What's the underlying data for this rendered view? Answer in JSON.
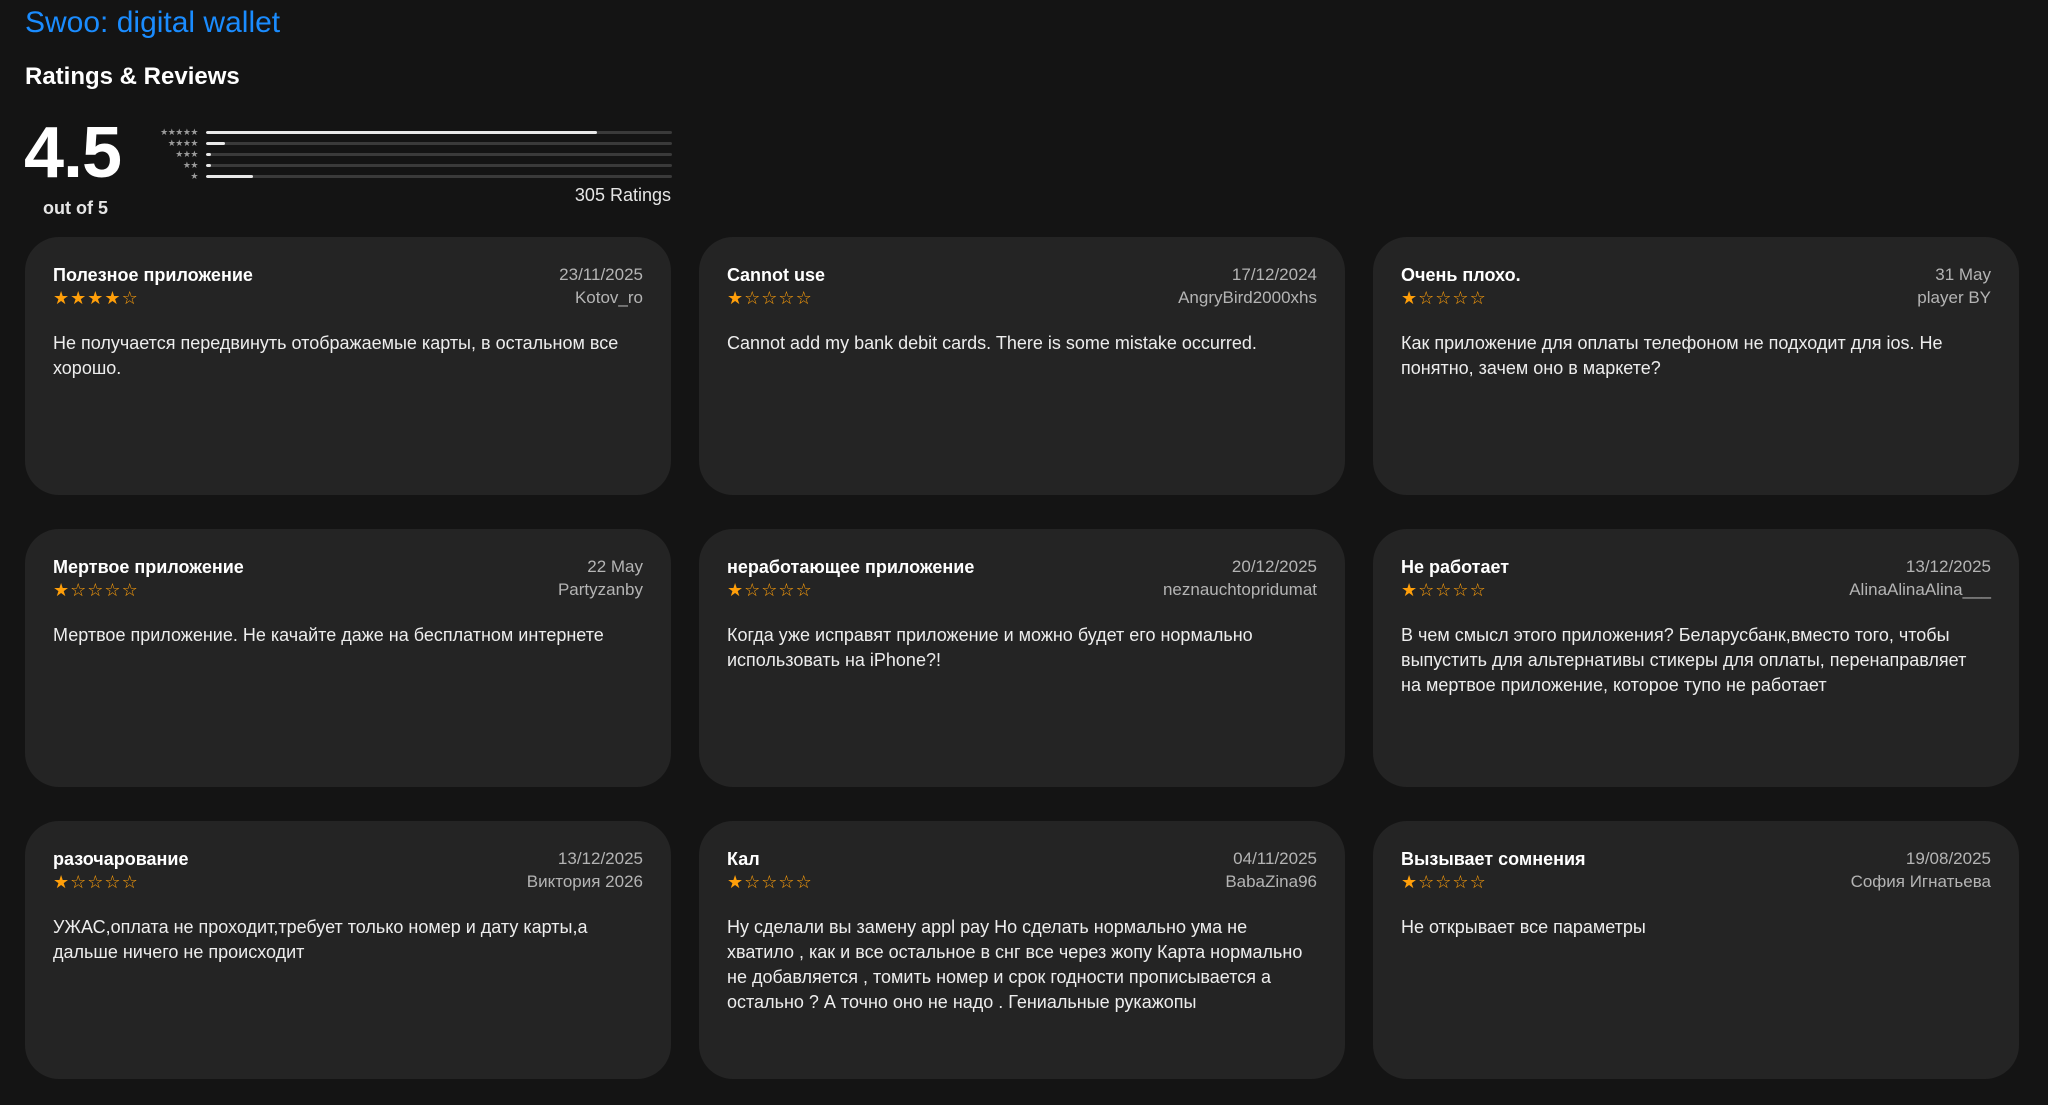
{
  "app": {
    "title": "Swoo: digital wallet"
  },
  "ratings": {
    "section_title": "Ratings & Reviews",
    "score": "4.5",
    "out_of": "out of 5",
    "count_label": "305 Ratings",
    "histogram": [
      {
        "stars": 5,
        "label": "★★★★★",
        "fraction": 0.84
      },
      {
        "stars": 4,
        "label": "★★★★",
        "fraction": 0.04
      },
      {
        "stars": 3,
        "label": "★★★",
        "fraction": 0.01
      },
      {
        "stars": 2,
        "label": "★★",
        "fraction": 0.01
      },
      {
        "stars": 1,
        "label": "★",
        "fraction": 0.1
      }
    ]
  },
  "colors": {
    "accent": "#1a8cff",
    "star": "#ff9f0a",
    "card_bg": "#242424",
    "page_bg": "#141414"
  },
  "reviews": [
    {
      "title": "Полезное приложение",
      "date": "23/11/2025",
      "author": "Kotov_ro",
      "rating": 4,
      "body": "Не получается передвинуть отображаемые карты, в остальном все хорошо."
    },
    {
      "title": "Cannot use",
      "date": "17/12/2024",
      "author": "AngryBird2000xhs",
      "rating": 1,
      "body": "Cannot add my bank debit cards. There is some mistake occurred."
    },
    {
      "title": "Очень плохо.",
      "date": "31 May",
      "author": "player BY",
      "rating": 1,
      "body": "Как приложение для оплаты телефоном не подходит для ios. Не понятно, зачем оно в маркете?"
    },
    {
      "title": "Мертвое приложение",
      "date": "22 May",
      "author": "Partyzanby",
      "rating": 1,
      "body": "Мертвое приложение. Не качайте даже на бесплатном интернете"
    },
    {
      "title": "неработающее приложение",
      "date": "20/12/2025",
      "author": "neznauchtopridumat",
      "rating": 1,
      "body": "Когда уже исправят приложение и можно будет его нормально использовать на iPhone?!"
    },
    {
      "title": "Не работает",
      "date": "13/12/2025",
      "author": "AlinaAlinaAlina___",
      "rating": 1,
      "body": "В чем смысл этого приложения? Беларусбанк,вместо того, чтобы выпустить для альтернативы стикеры для оплаты, перенаправляет на мертвое приложение, которое тупо не работает"
    },
    {
      "title": "разочарование",
      "date": "13/12/2025",
      "author": "Виктория 2026",
      "rating": 1,
      "body": "УЖАС,оплата не проходит,требует только номер и дату карты,а дальше ничего не происходит"
    },
    {
      "title": "Кал",
      "date": "04/11/2025",
      "author": "BabaZina96",
      "rating": 1,
      "body": "Ну сделали вы замену appl pay Но сделать нормально ума не хватило , как и все остальное в снг все через жопу Карта нормально не добавляется , томить номер и срок годности прописывается а остально ? А точно оно не надо . Гениальные рукажопы"
    },
    {
      "title": "Вызывает сомнения",
      "date": "19/08/2025",
      "author": "София Игнатьева",
      "rating": 1,
      "body": "Не открывает все параметры"
    }
  ]
}
